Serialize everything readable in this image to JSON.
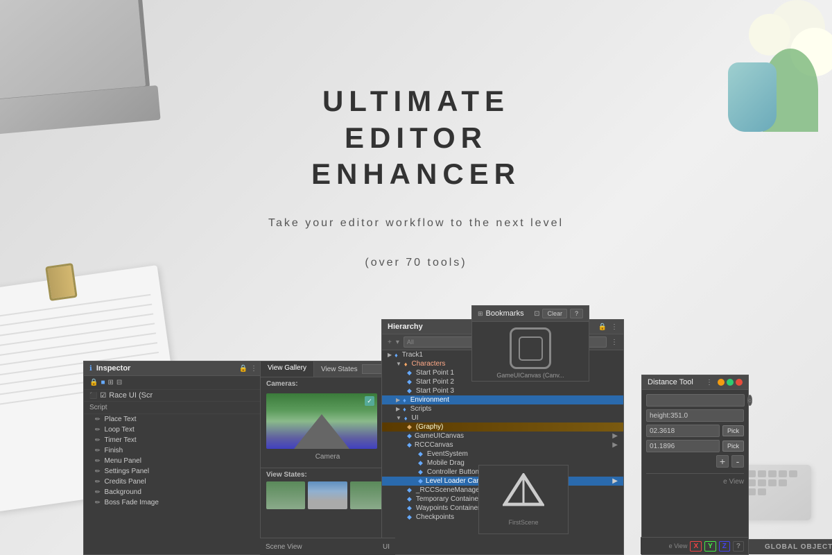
{
  "app": {
    "title": "Ultimate Editor Enhancer"
  },
  "hero": {
    "line1": "ULTIMATE",
    "line2": "EDITOR",
    "line3": "ENHANCER",
    "subtitle1": "Take your editor workflow to the next level",
    "subtitle2": "(over 70 tools)"
  },
  "inspector": {
    "title": "Inspector",
    "component_name": "Race UI (Scr",
    "script_label": "Script",
    "items": [
      "Place Text",
      "Loop Text",
      "Timer Text",
      "Finish",
      "Menu Panel",
      "Settings Panel",
      "Credits Panel",
      "Background",
      "Boss Fade Image"
    ]
  },
  "view_gallery": {
    "tab1": "View Gallery",
    "tab2": "View States",
    "cameras_label": "Cameras:",
    "camera_name": "Camera",
    "view_states_label": "View States:"
  },
  "hierarchy": {
    "title": "Hierarchy",
    "search_placeholder": "All",
    "items": [
      {
        "name": "Track1",
        "indent": 0,
        "icon": "▶",
        "type": "root"
      },
      {
        "name": "Characters",
        "indent": 1,
        "icon": "▼",
        "type": "folder",
        "color": "orange"
      },
      {
        "name": "Start Point 1",
        "indent": 2,
        "icon": "◆",
        "type": "object"
      },
      {
        "name": "Start Point 2",
        "indent": 2,
        "icon": "◆",
        "type": "object"
      },
      {
        "name": "Start Point 3",
        "indent": 2,
        "icon": "◆",
        "type": "object"
      },
      {
        "name": "Environment",
        "indent": 1,
        "icon": "▶",
        "type": "folder",
        "selected": true
      },
      {
        "name": "Scripts",
        "indent": 1,
        "icon": "▶",
        "type": "folder"
      },
      {
        "name": "UI",
        "indent": 1,
        "icon": "▼",
        "type": "folder"
      },
      {
        "name": "(Graphy)",
        "indent": 2,
        "icon": "◆",
        "type": "object",
        "highlighted": true
      },
      {
        "name": "GameUICanvas",
        "indent": 2,
        "icon": "◆",
        "type": "canvas",
        "arrow": true
      },
      {
        "name": "RCCCanvas",
        "indent": 2,
        "icon": "◆",
        "type": "canvas",
        "arrow": true
      },
      {
        "name": "EventSystem",
        "indent": 3,
        "icon": "◆",
        "type": "object"
      },
      {
        "name": "Mobile Drag",
        "indent": 3,
        "icon": "◆",
        "type": "object"
      },
      {
        "name": "Controller Buttons",
        "indent": 3,
        "icon": "◆",
        "type": "object"
      },
      {
        "name": "Level Loader Canvas",
        "indent": 3,
        "icon": "◆",
        "type": "canvas",
        "selected": true,
        "arrow": true
      },
      {
        "name": "_RCCSceneManager",
        "indent": 2,
        "icon": "◆",
        "type": "object"
      },
      {
        "name": "Temporary Container",
        "indent": 2,
        "icon": "◆",
        "type": "object"
      },
      {
        "name": "Waypoints Container",
        "indent": 2,
        "icon": "◆",
        "type": "object"
      },
      {
        "name": "Checkpoints",
        "indent": 2,
        "icon": "◆",
        "type": "object"
      }
    ],
    "global_objects_label": "GLOBAL OBJECTS"
  },
  "bookmarks": {
    "title": "Bookmarks",
    "clear_btn": "Clear",
    "help_btn": "?",
    "canvas_label": "GameUICanvas (Canv..."
  },
  "distance_tool": {
    "title": "Distance Tool",
    "value1": "height:351.0",
    "value2_label": "02.3618",
    "value3_label": "01.1896",
    "pick_btn": "Pick",
    "plus_btn": "+",
    "minus_btn": "-",
    "view_label": "e View"
  },
  "bottom_bar": {
    "scene_view": "Scene View",
    "ui_label": "UI"
  },
  "xyz": {
    "x": "X",
    "y": "Y",
    "z": "Z",
    "q": "?"
  }
}
